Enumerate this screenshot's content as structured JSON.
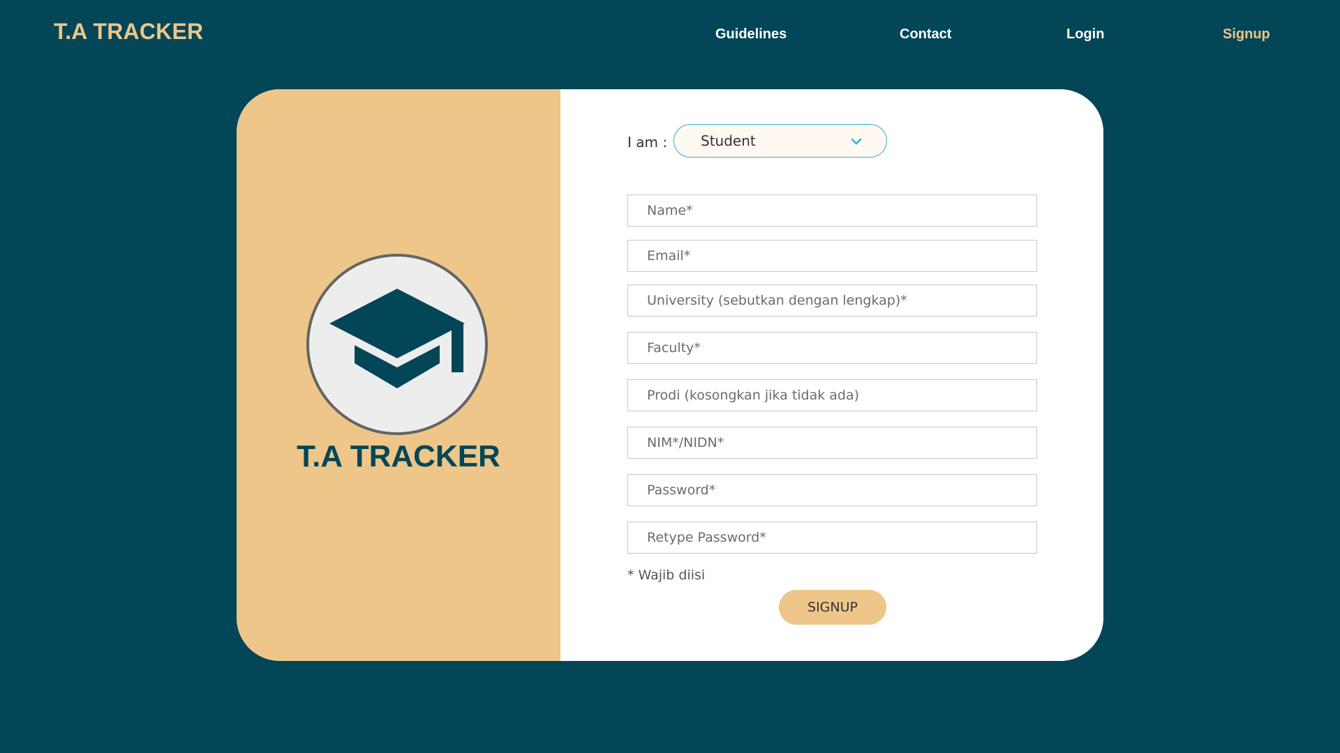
{
  "header": {
    "brand": "T.A TRACKER",
    "nav": {
      "guidelines": "Guidelines",
      "contact": "Contact",
      "login": "Login",
      "signup": "Signup"
    }
  },
  "left_panel": {
    "logo_icon": "graduation-cap-icon",
    "logo_text": "T.A TRACKER"
  },
  "form": {
    "role_label": "I am :",
    "role_value": "Student",
    "fields": {
      "name": "Name*",
      "email": "Email*",
      "university": "University (sebutkan dengan lengkap)*",
      "faculty": "Faculty*",
      "prodi": "Prodi (kosongkan jika tidak ada)",
      "nim": "NIM*/NIDN*",
      "password": "Password*",
      "retype_password": "Retype Password*"
    },
    "required_note": "* Wajib diisi",
    "submit_label": "SIGNUP"
  },
  "colors": {
    "background": "#034657",
    "accent": "#EEC689",
    "select_border": "#2AB3C8"
  }
}
